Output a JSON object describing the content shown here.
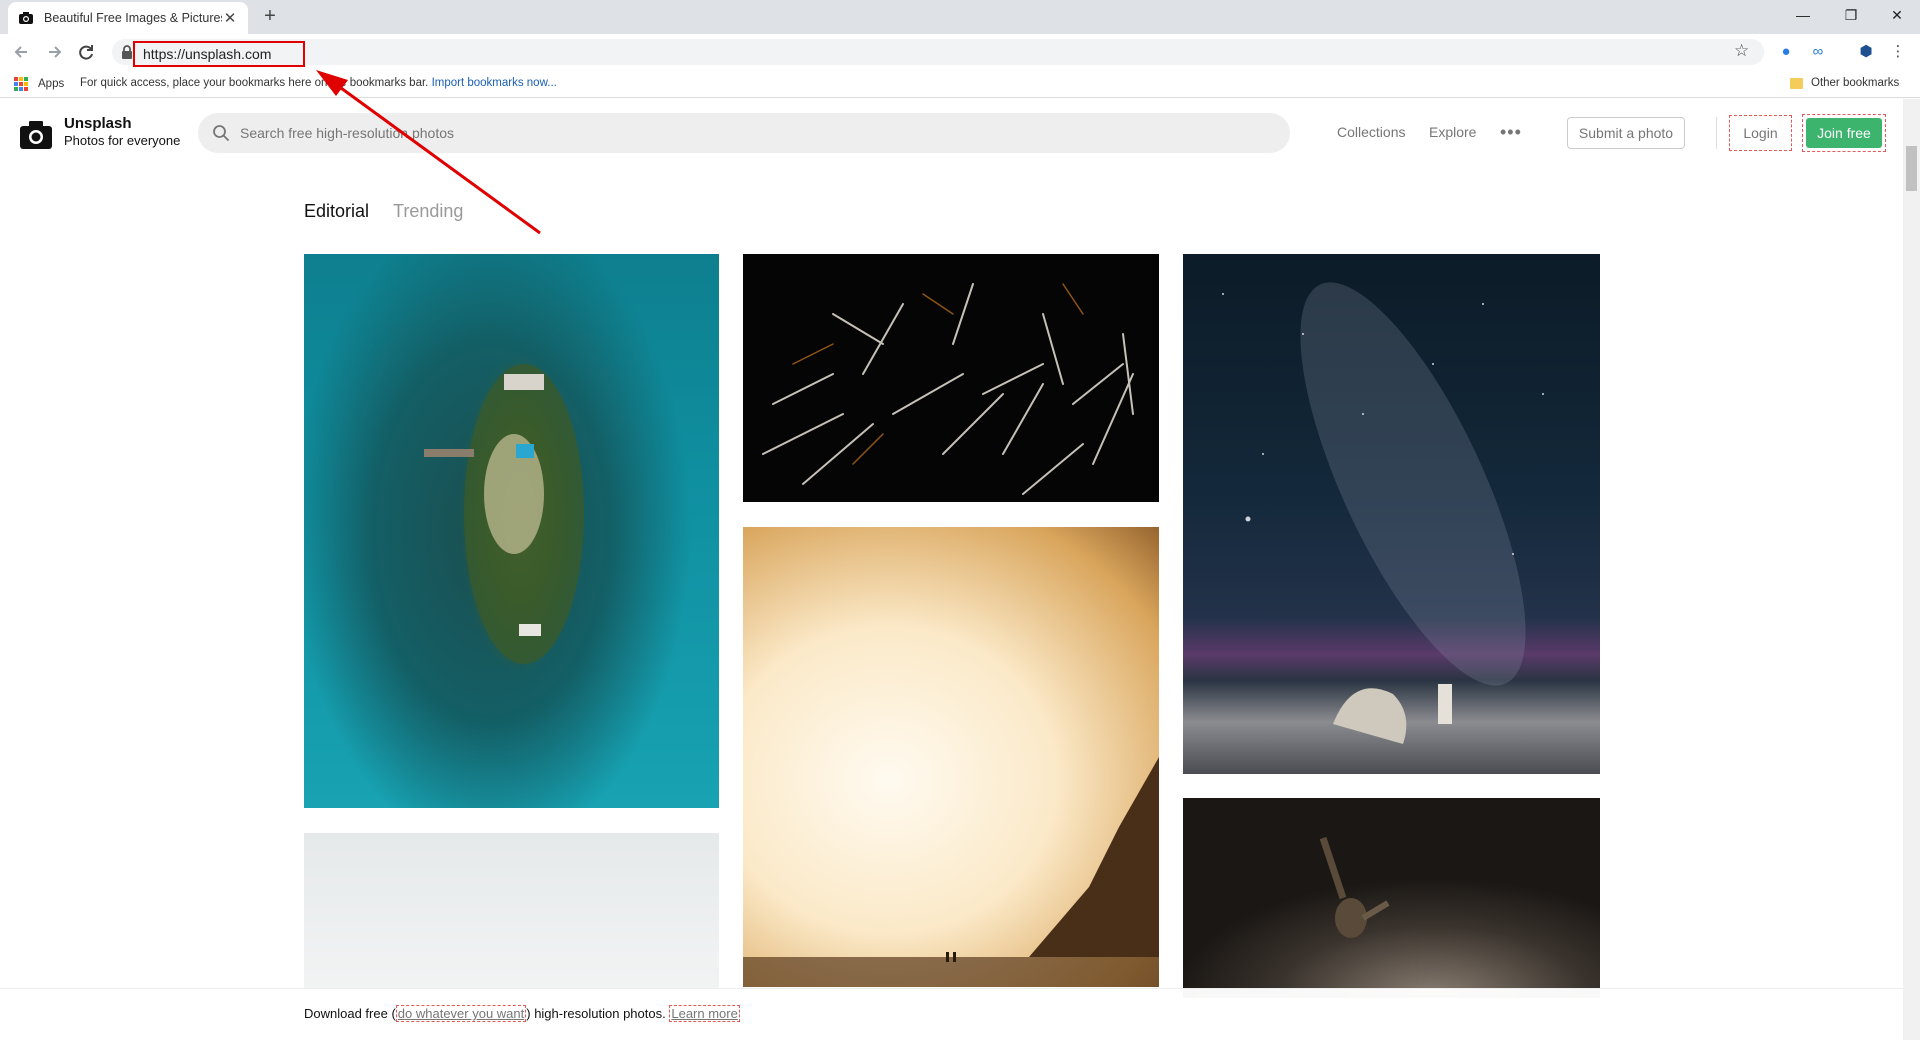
{
  "browser": {
    "tab_title": "Beautiful Free Images & Pictures",
    "new_tab_glyph": "+",
    "close_tab_glyph": "✕",
    "url": "https://unsplash.com",
    "window_controls": {
      "minimize": "—",
      "restore": "❐",
      "close": "✕"
    },
    "bookmarks": {
      "apps_label": "Apps",
      "hint_text": "For quick access, place your bookmarks here on the bookmarks bar.",
      "import_link": "Import bookmarks now...",
      "other_label": "Other bookmarks"
    }
  },
  "header": {
    "brand_name": "Unsplash",
    "brand_tagline": "Photos for everyone",
    "search_placeholder": "Search free high-resolution photos",
    "nav": {
      "collections": "Collections",
      "explore": "Explore",
      "more": "•••"
    },
    "submit_label": "Submit a photo",
    "login_label": "Login",
    "join_label": "Join free"
  },
  "feed": {
    "tabs": [
      {
        "label": "Editorial",
        "active": true
      },
      {
        "label": "Trending",
        "active": false
      }
    ]
  },
  "banner": {
    "prefix": "Download free (",
    "link1": "do whatever you want",
    "middle": ") high-resolution photos.",
    "link2": "Learn more"
  },
  "colors": {
    "accent_green": "#3cb46e",
    "annotation_red": "#e00000",
    "muted_text": "#767676"
  },
  "icons": [
    "camera-icon",
    "search-icon",
    "back-icon",
    "forward-icon",
    "reload-icon",
    "lock-icon",
    "star-icon",
    "apps-grid-icon",
    "folder-icon"
  ]
}
